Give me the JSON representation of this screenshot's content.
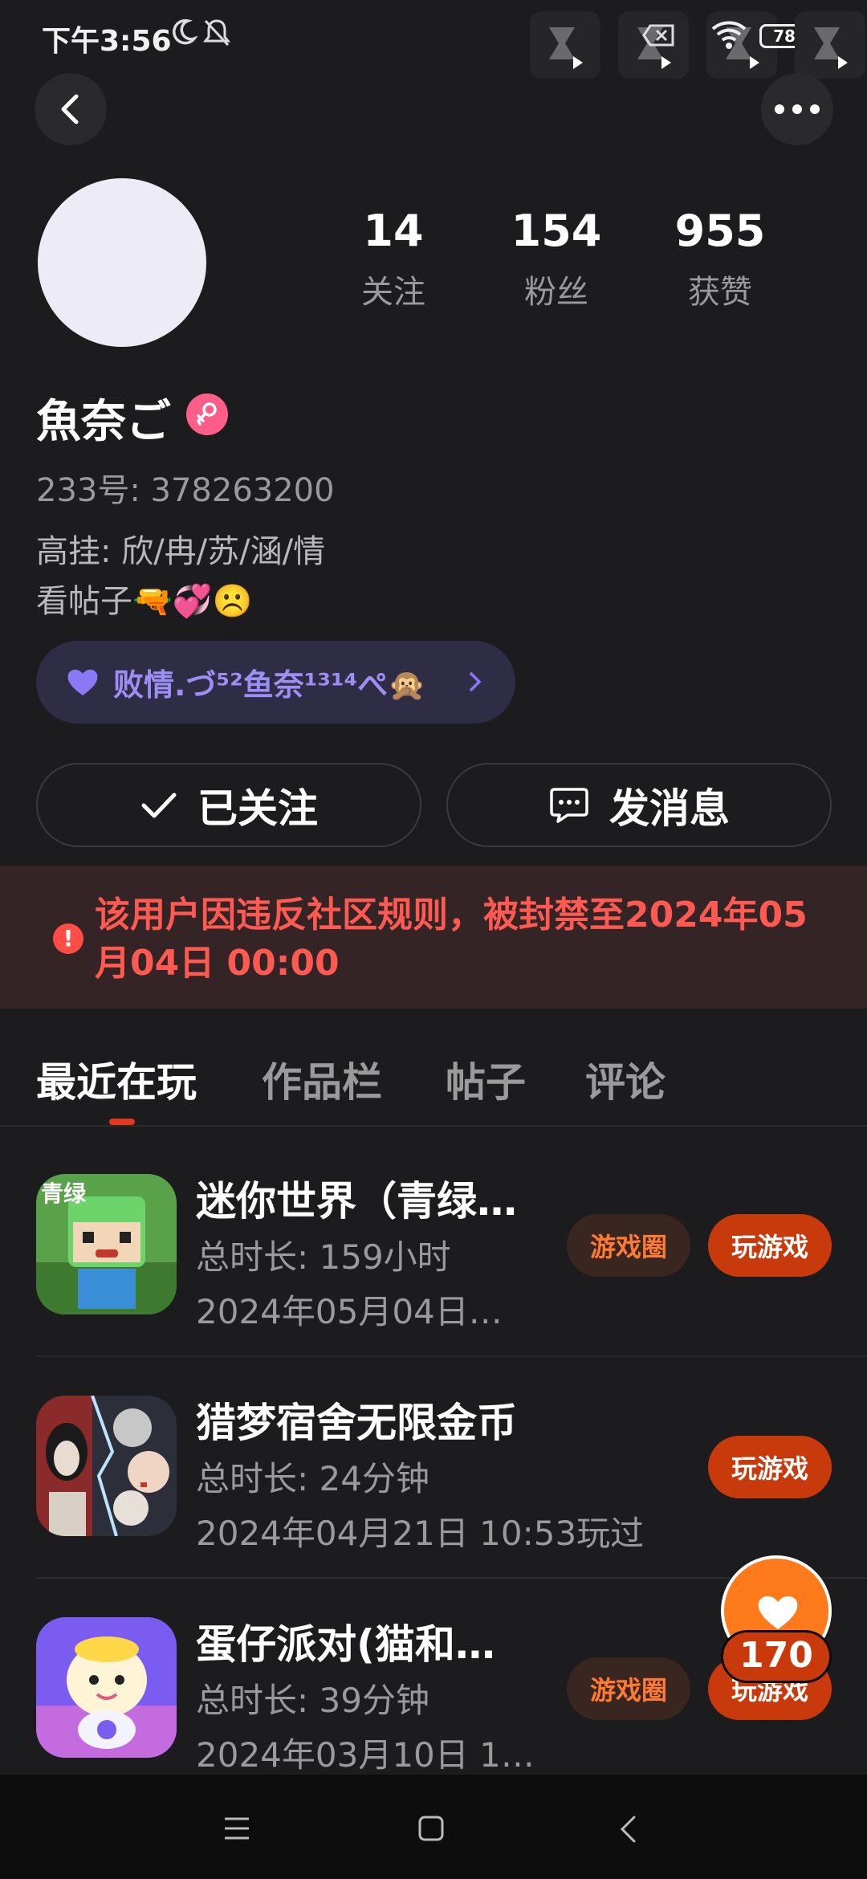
{
  "status_bar": {
    "time": "下午3:56",
    "battery": "78"
  },
  "profile": {
    "stats": [
      {
        "value": "14",
        "label": "关注"
      },
      {
        "value": "154",
        "label": "粉丝"
      },
      {
        "value": "955",
        "label": "获赞"
      }
    ],
    "nickname": "魚奈ご",
    "uid": "233号: 378263200",
    "bio_line1": "高挂: 欣/冉/苏/涵/情",
    "bio_line2": "看帖子🔫💞☹️",
    "group_name": "败情.づ⁵²鱼奈¹³¹⁴ぺ🙊",
    "follow_label": "已关注",
    "message_label": "发消息",
    "ban_notice": "该用户因违反社区规则，被封禁至2024年05月04日 00:00"
  },
  "tabs": [
    {
      "label": "最近在玩"
    },
    {
      "label": "作品栏"
    },
    {
      "label": "帖子"
    },
    {
      "label": "评论"
    }
  ],
  "games": [
    {
      "title": "迷你世界（青绿…",
      "duration": "总时长: 159小时",
      "last_played": "2024年05月04日…",
      "circle_label": "游戏圈",
      "play_label": "玩游戏"
    },
    {
      "title": "猎梦宿舍无限金币",
      "duration": "总时长: 24分钟",
      "last_played": "2024年04月21日 10:53玩过",
      "play_label": "玩游戏"
    },
    {
      "title": "蛋仔派对(猫和…",
      "duration": "总时长: 39分钟",
      "last_played": "2024年03月10日 1…",
      "circle_label": "游戏圈",
      "play_label": "玩游戏"
    }
  ],
  "like_float": {
    "count": "170"
  },
  "colors": {
    "background": "#1c1c1e",
    "accent": "#c8390c",
    "ban_text": "#ff5a52",
    "group_text": "#9c8ef5"
  }
}
